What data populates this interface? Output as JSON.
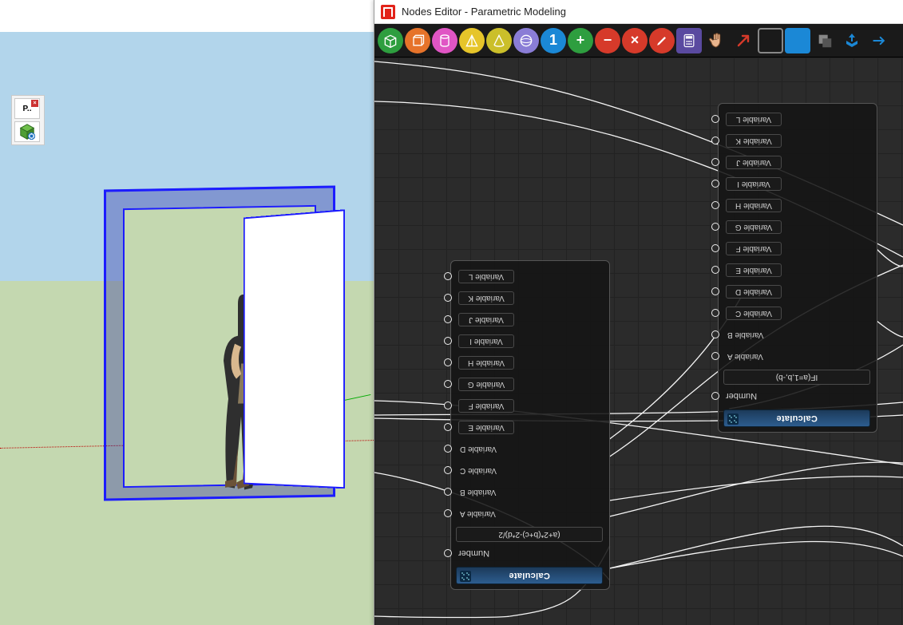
{
  "viewport": {
    "mini_toolbar": {
      "label": "P.."
    }
  },
  "editor": {
    "window_title": "Nodes Editor - Parametric Modeling",
    "toolbar_semantic": [
      "box",
      "prism",
      "cylinder",
      "pyramid",
      "cone",
      "sphere",
      "number-one",
      "add",
      "subtract",
      "multiply",
      "divide",
      "calculator",
      "point",
      "measure",
      "boolean-subtract",
      "boolean-union",
      "copy",
      "push-pull",
      "arrow"
    ]
  },
  "nodes": {
    "a": {
      "title": "Calculate",
      "number_label": "Number",
      "formula": "(a+2*(b+c)-2*d)/2",
      "vars_plain": [
        {
          "l": "Variable A"
        },
        {
          "l": "Variable B"
        },
        {
          "l": "Variable C"
        },
        {
          "l": "Variable D"
        }
      ],
      "vars_pill": [
        {
          "l": "Variable E"
        },
        {
          "l": "Variable F"
        },
        {
          "l": "Variable G"
        },
        {
          "l": "Variable H"
        },
        {
          "l": "Variable I"
        },
        {
          "l": "Variable J"
        },
        {
          "l": "Variable K"
        },
        {
          "l": "Variable L"
        }
      ]
    },
    "b": {
      "title": "Calculate",
      "number_label": "Number",
      "formula": "IF(a=1,b,-b)",
      "vars_plain": [
        {
          "l": "Variable A"
        },
        {
          "l": "Variable B"
        }
      ],
      "vars_pill": [
        {
          "l": "Variable C"
        },
        {
          "l": "Variable D"
        },
        {
          "l": "Variable E"
        },
        {
          "l": "Variable F"
        },
        {
          "l": "Variable G"
        },
        {
          "l": "Variable H"
        },
        {
          "l": "Variable I"
        },
        {
          "l": "Variable J"
        },
        {
          "l": "Variable K"
        },
        {
          "l": "Variable L"
        }
      ]
    }
  }
}
